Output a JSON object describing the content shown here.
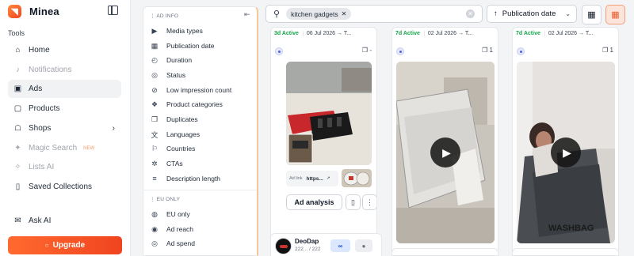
{
  "app": {
    "name": "Minea",
    "logo_glyph": "◥",
    "accent": "#f0441f"
  },
  "sidebar": {
    "section_label": "Tools",
    "items": [
      {
        "label": "Home",
        "icon": "home-icon",
        "glyph": "⌂",
        "active": false,
        "dim": false
      },
      {
        "label": "Notifications",
        "icon": "bell-icon",
        "glyph": "♪",
        "active": false,
        "dim": true
      },
      {
        "label": "Ads",
        "icon": "ads-icon",
        "glyph": "▣",
        "active": true,
        "dim": false
      },
      {
        "label": "Products",
        "icon": "box-icon",
        "glyph": "▢",
        "active": false,
        "dim": false
      },
      {
        "label": "Shops",
        "icon": "shop-icon",
        "glyph": "☖",
        "active": false,
        "dim": false
      },
      {
        "label": "Magic Search",
        "icon": "magic-icon",
        "glyph": "✦",
        "active": false,
        "dim": true,
        "badge": "NEW"
      },
      {
        "label": "Lists AI",
        "icon": "sparkle-icon",
        "glyph": "✧",
        "active": false,
        "dim": true
      },
      {
        "label": "Saved Collections",
        "icon": "bookmark-icon",
        "glyph": "▯",
        "active": false,
        "dim": false
      },
      {
        "label": "Ask AI",
        "icon": "chat-icon",
        "glyph": "✉",
        "active": false,
        "dim": false
      }
    ],
    "upgrade_label": "Upgrade",
    "upgrade_icon": "lock-icon"
  },
  "filters": {
    "ad_info_label": "AD INFO",
    "ad_info_items": [
      {
        "label": "Media types",
        "glyph": "▶"
      },
      {
        "label": "Publication date",
        "glyph": "▦"
      },
      {
        "label": "Duration",
        "glyph": "◴"
      },
      {
        "label": "Status",
        "glyph": "◎"
      },
      {
        "label": "Low impression count",
        "glyph": "⊘"
      },
      {
        "label": "Product categories",
        "glyph": "❖"
      },
      {
        "label": "Duplicates",
        "glyph": "❐"
      },
      {
        "label": "Languages",
        "glyph": "文"
      },
      {
        "label": "Countries",
        "glyph": "⚐"
      },
      {
        "label": "CTAs",
        "glyph": "✲"
      },
      {
        "label": "Description length",
        "glyph": "≡"
      }
    ],
    "eu_only_label": "EU ONLY",
    "eu_items": [
      {
        "label": "EU only",
        "glyph": "◍"
      },
      {
        "label": "Ad reach",
        "glyph": "◉"
      },
      {
        "label": "Ad spend",
        "glyph": "◎"
      }
    ]
  },
  "search": {
    "chip": "kitchen gadgets"
  },
  "sort": {
    "label": "Publication date"
  },
  "cards": [
    {
      "status": "3d Active",
      "date": "06 Jul 2026 → T...",
      "dup_count": "-",
      "link_label": "Ad link",
      "link_text": "https...",
      "analysis_label": "Ad analysis"
    },
    {
      "status": "7d Active",
      "date": "02 Jul 2026 → T...",
      "dup_count": "1"
    },
    {
      "status": "7d Active",
      "date": "02 Jul 2026 → T...",
      "dup_count": "1"
    }
  ],
  "shop_card": {
    "name": "DeoDap",
    "count": "222... / 222"
  }
}
